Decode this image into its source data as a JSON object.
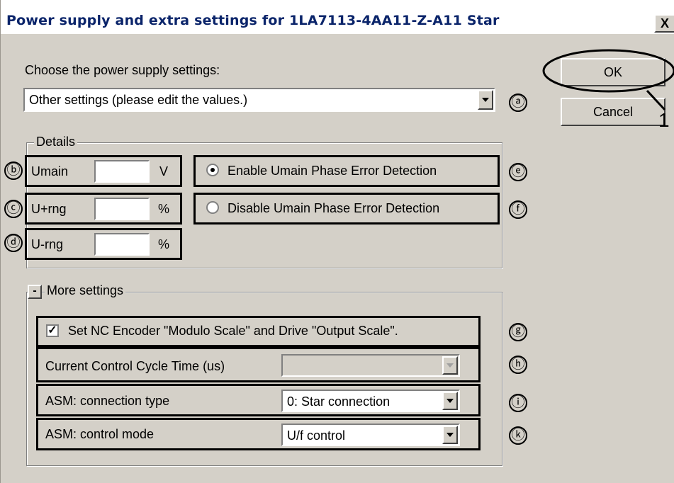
{
  "window": {
    "title": "Power supply and extra settings for 1LA7113-4AA11-Z-A11 Star",
    "close_symbol": "X"
  },
  "buttons": {
    "ok": "OK",
    "cancel": "Cancel"
  },
  "callout_number": "1",
  "supply": {
    "prompt": "Choose the power supply settings:",
    "selected": "Other settings (please edit the values.)"
  },
  "details": {
    "title": "Details",
    "fields": [
      {
        "label": "Umain",
        "value": "",
        "unit": "V"
      },
      {
        "label": "U+rng",
        "value": "",
        "unit": "%"
      },
      {
        "label": "U-rng",
        "value": "",
        "unit": "%"
      }
    ],
    "radios": [
      {
        "label": "Enable Umain Phase Error Detection",
        "selected": true
      },
      {
        "label": "Disable Umain Phase Error Detection",
        "selected": false
      }
    ]
  },
  "more": {
    "toggle": "-",
    "title": "More settings",
    "checkbox_label": "Set NC Encoder \"Modulo Scale\" and Drive \"Output Scale\".",
    "checkbox_checked": true,
    "rows": [
      {
        "label": "Current Control Cycle Time (us)",
        "value": "",
        "enabled": false
      },
      {
        "label": "ASM: connection type",
        "value": "0: Star connection",
        "enabled": true
      },
      {
        "label": "ASM: control mode",
        "value": "U/f control",
        "enabled": true
      }
    ]
  },
  "markers": {
    "a": "ⓐ",
    "b": "ⓑ",
    "c": "ⓒ",
    "d": "ⓓ",
    "e": "ⓔ",
    "f": "ⓕ",
    "g": "ⓖ",
    "h": "ⓗ",
    "i": "ⓘ",
    "k": "ⓚ"
  },
  "colors": {
    "dialog_bg": "#d4d0c8",
    "title_text": "#0a246a"
  }
}
